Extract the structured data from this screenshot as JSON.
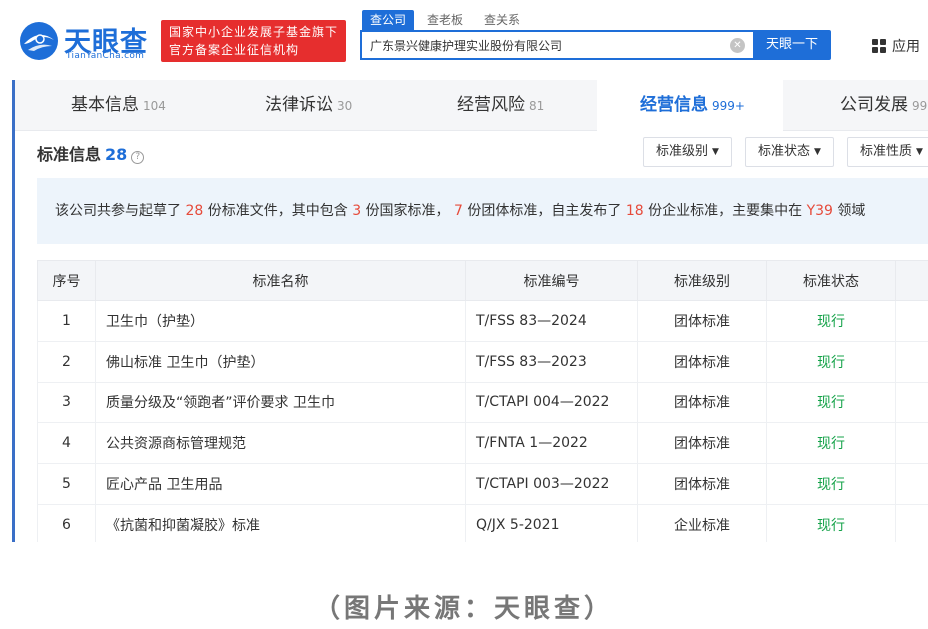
{
  "logo": {
    "cn": "天眼查",
    "en": "TianYanCha.com"
  },
  "org_badge": {
    "line1": "国家中小企业发展子基金旗下",
    "line2": "官方备案企业征信机构"
  },
  "search": {
    "tabs": [
      "查公司",
      "查老板",
      "查关系"
    ],
    "query": "广东景兴健康护理实业股份有限公司",
    "button_label": "天眼一下"
  },
  "apps_label": "应用",
  "main_tabs": [
    {
      "label": "基本信息",
      "count": "104"
    },
    {
      "label": "法律诉讼",
      "count": "30"
    },
    {
      "label": "经营风险",
      "count": "81"
    },
    {
      "label": "经营信息",
      "count": "999+"
    },
    {
      "label": "公司发展",
      "count": "99"
    }
  ],
  "section": {
    "title": "标准信息",
    "count": "28",
    "info_icon": "?"
  },
  "filters": [
    "标准级别",
    "标准状态",
    "标准性质"
  ],
  "summary": {
    "p1": "该公司共参与起草了",
    "n1": "28",
    "p2": "份标准文件，其中包含",
    "n2": "3",
    "p3": "份国家标准，",
    "n3": "7",
    "p4": "份团体标准，自主发布了",
    "n4": "18",
    "p5": "份企业标准，主要集中在",
    "n5": "Y39",
    "p6": "领域"
  },
  "table": {
    "headers": [
      "序号",
      "标准名称",
      "标准编号",
      "标准级别",
      "标准状态"
    ],
    "rows": [
      {
        "no": "1",
        "name": "卫生巾（护垫）",
        "code": "T/FSS 83—2024",
        "level": "团体标准",
        "status": "现行"
      },
      {
        "no": "2",
        "name": "佛山标准 卫生巾（护垫）",
        "code": "T/FSS 83—2023",
        "level": "团体标准",
        "status": "现行"
      },
      {
        "no": "3",
        "name": "质量分级及“领跑者”评价要求 卫生巾",
        "code": "T/CTAPI 004—2022",
        "level": "团体标准",
        "status": "现行"
      },
      {
        "no": "4",
        "name": "公共资源商标管理规范",
        "code": "T/FNTA 1—2022",
        "level": "团体标准",
        "status": "现行"
      },
      {
        "no": "5",
        "name": "匠心产品 卫生用品",
        "code": "T/CTAPI 003—2022",
        "level": "团体标准",
        "status": "现行"
      },
      {
        "no": "6",
        "name": "《抗菌和抑菌凝胶》标准",
        "code": "Q/JX 5-2021",
        "level": "企业标准",
        "status": "现行"
      }
    ]
  },
  "caption": "（图片来源：天眼查）",
  "colors": {
    "brand": "#1e6ed8",
    "badge": "#e62e2e",
    "highlight": "#e64b3b",
    "status_current": "#16a34a"
  }
}
